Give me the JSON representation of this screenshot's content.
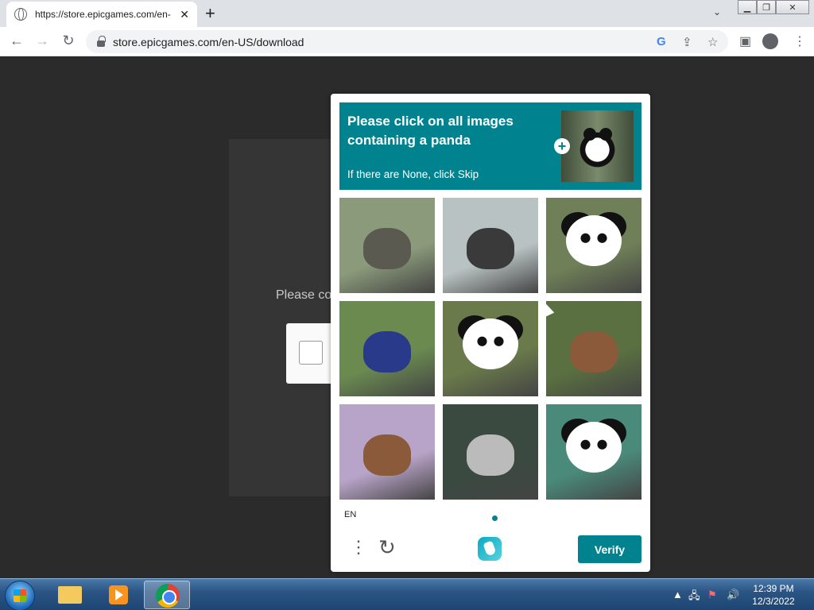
{
  "browser": {
    "tab_title": "https://store.epicgames.com/en-",
    "url": "store.epicgames.com/en-US/download"
  },
  "page": {
    "background_text": "Please co"
  },
  "captcha": {
    "prompt_title": "Please click on all images containing a panda",
    "prompt_subtitle": "If there are None, click Skip",
    "language": "EN",
    "verify_label": "Verify",
    "tiles": [
      {
        "subject": "squirrel",
        "colors": [
          "#8a9a7a",
          "#5a5a50"
        ]
      },
      {
        "subject": "raccoon",
        "colors": [
          "#b9c2c2",
          "#3a3a3a"
        ]
      },
      {
        "subject": "panda",
        "colors": [
          "#6f7f58",
          "#ffffff"
        ]
      },
      {
        "subject": "raccoon",
        "colors": [
          "#6a8a50",
          "#2a3a8a"
        ]
      },
      {
        "subject": "panda",
        "colors": [
          "#6a7a4a",
          "#ffffff"
        ]
      },
      {
        "subject": "rodent",
        "colors": [
          "#5a7040",
          "#8a5a3a"
        ]
      },
      {
        "subject": "rabbit",
        "colors": [
          "#b9a4c9",
          "#8a5a3a"
        ]
      },
      {
        "subject": "rabbit",
        "colors": [
          "#3a4a40",
          "#bbbbbb"
        ]
      },
      {
        "subject": "panda",
        "colors": [
          "#4a8a7a",
          "#ffffff"
        ]
      }
    ],
    "accent_color": "#00838f"
  },
  "taskbar": {
    "time": "12:39 PM",
    "date": "12/3/2022"
  }
}
